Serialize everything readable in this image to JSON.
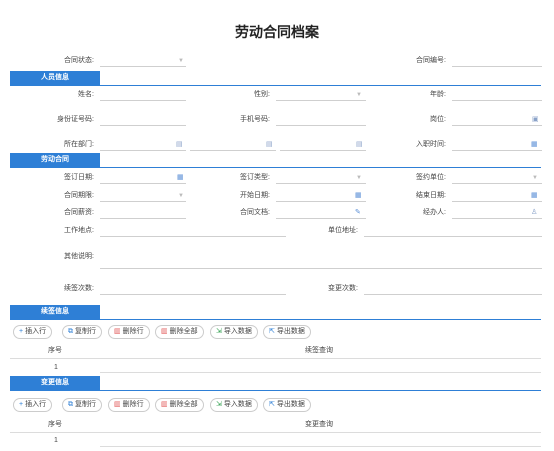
{
  "title": "劳动合同档案",
  "top": {
    "status_label": "合同状态:",
    "number_label": "合同编号:"
  },
  "sections": {
    "personal": "人员信息",
    "contract": "劳动合同",
    "renew": "续签信息",
    "change": "变更信息"
  },
  "personal": {
    "name": "姓名:",
    "gender": "性别:",
    "age": "年龄:",
    "idcard": "身份证号码:",
    "phone": "手机号码:",
    "post": "岗位:",
    "dept": "所在部门:",
    "join": "入职时间:"
  },
  "contract": {
    "sign_date": "签订日期:",
    "sign_type": "签订类型:",
    "sign_unit": "签约单位:",
    "term": "合同期限:",
    "start": "开始日期:",
    "end": "结束日期:",
    "salary": "合同薪资:",
    "doc": "合同文档:",
    "handler": "经办人:",
    "workplace": "工作地点:",
    "unit_addr": "单位地址:",
    "other": "其他说明:",
    "renew_count": "续签次数:",
    "change_count": "变更次数:"
  },
  "toolbar": {
    "insert": "插入行",
    "copy": "复制行",
    "delete": "删除行",
    "delete_all": "删除全部",
    "import": "导入数据",
    "export": "导出数据"
  },
  "renew_table": {
    "col_seq": "序号",
    "col_query": "续签查询",
    "row1": "1"
  },
  "change_table": {
    "col_seq": "序号",
    "col_query": "变更查询",
    "row1": "1"
  },
  "icons": {
    "caret": "caret-down-icon",
    "calendar": "calendar-icon",
    "org": "org-picker-icon",
    "id": "id-card-icon",
    "clip": "paperclip-icon",
    "user": "user-icon"
  },
  "colors": {
    "accent": "#2e7fd6"
  }
}
